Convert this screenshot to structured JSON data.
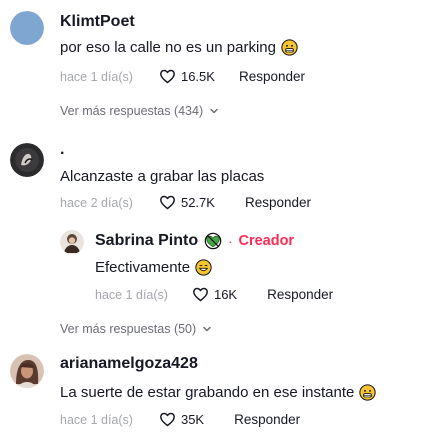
{
  "colors": {
    "accent": "#fe2c55",
    "muted": "#a5a7ad",
    "text": "#161823",
    "avatar_blue": "#7fa6d1"
  },
  "comments": [
    {
      "username": "KlimtPoet",
      "text": "por eso la calle no es un parking",
      "emoji": "grimace-emoji",
      "time": "hace 1 día(s)",
      "likes": "16.5K",
      "reply_label": "Responder",
      "more_replies": "Ver más respuestas (434)"
    },
    {
      "username": ".",
      "text": "Alcanzaste a grabar las placas",
      "time": "hace 2 día(s)",
      "likes": "52.7K",
      "reply_label": "Responder",
      "reply": {
        "username": "Sabrina Pinto",
        "badge_icon": "no-sign-heart-icon",
        "separator": "·",
        "creator_label": "Creador",
        "text": "Efectivamente",
        "emoji": "grin-emoji",
        "time": "hace 1 día(s)",
        "likes": "16K",
        "reply_label": "Responder"
      },
      "more_replies": "Ver más respuestas (50)"
    },
    {
      "username": "arianamelgoza428",
      "text": "La suerte de estar grabando en ese instante",
      "emoji": "grimace-emoji",
      "time": "hace 1 día(s)",
      "likes": "35K",
      "reply_label": "Responder"
    }
  ]
}
